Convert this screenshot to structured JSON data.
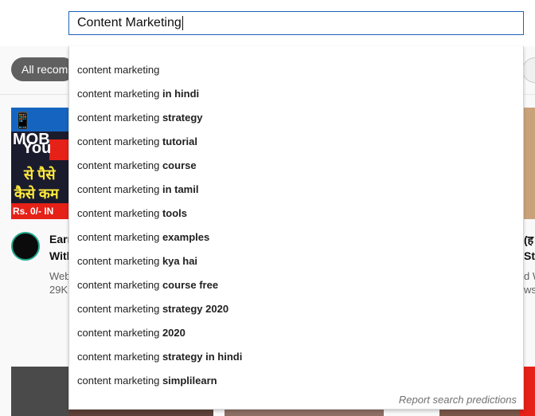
{
  "search": {
    "value": "Content Marketing"
  },
  "chips": {
    "active_label": "All recom"
  },
  "thumbnail_left": {
    "line1": "📱MOB",
    "line2": "You",
    "line3": "से पैसे",
    "line4": "कैसे कम",
    "line5": "Rs. 0/- IN"
  },
  "video_left": {
    "title_line1": "Earr",
    "title_line2": "With",
    "meta_line1": "Web",
    "meta_line2": "29K"
  },
  "video_right": {
    "title_line1": "(ह",
    "title_line2": "Str",
    "meta_line1": "d W",
    "meta_line2": "ws"
  },
  "suggestions": [
    {
      "prefix": "content marketing",
      "suffix": ""
    },
    {
      "prefix": "content marketing",
      "suffix": " in hindi"
    },
    {
      "prefix": "content marketing",
      "suffix": " strategy"
    },
    {
      "prefix": "content marketing",
      "suffix": " tutorial"
    },
    {
      "prefix": "content marketing",
      "suffix": " course"
    },
    {
      "prefix": "content marketing",
      "suffix": " in tamil"
    },
    {
      "prefix": "content marketing",
      "suffix": " tools"
    },
    {
      "prefix": "content marketing",
      "suffix": " examples"
    },
    {
      "prefix": "content marketing",
      "suffix": " kya hai"
    },
    {
      "prefix": "content marketing",
      "suffix": " course free"
    },
    {
      "prefix": "content marketing",
      "suffix": " strategy 2020"
    },
    {
      "prefix": "content marketing",
      "suffix": " 2020"
    },
    {
      "prefix": "content marketing",
      "suffix": " strategy in hindi"
    },
    {
      "prefix": "content marketing",
      "suffix": " simplilearn"
    }
  ],
  "report_link": "Report search predictions"
}
